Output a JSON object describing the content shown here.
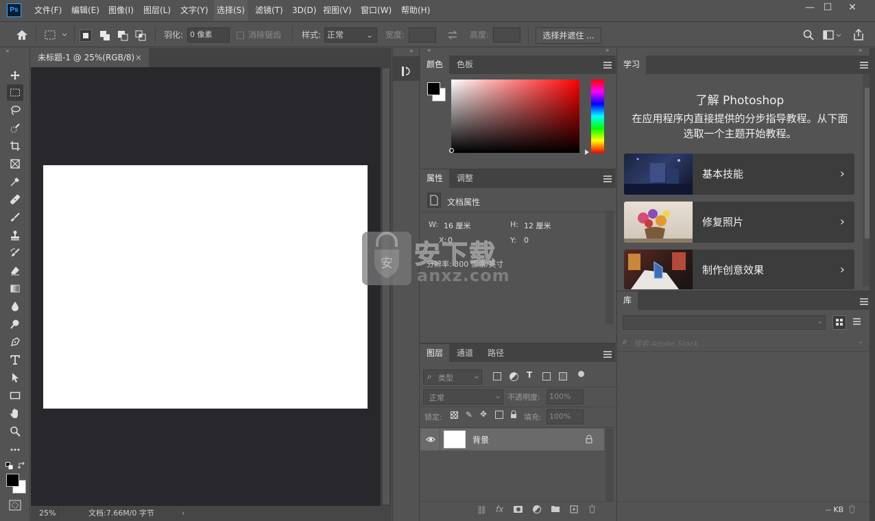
{
  "app": {
    "logo_text": "Ps"
  },
  "menubar": {
    "items": [
      "文件(F)",
      "编辑(E)",
      "图像(I)",
      "图层(L)",
      "文字(Y)",
      "选择(S)",
      "滤镜(T)",
      "3D(D)",
      "视图(V)",
      "窗口(W)",
      "帮助(H)"
    ]
  },
  "window_controls": {
    "minimize": "—",
    "maximize": "☐",
    "close": "✕"
  },
  "options": {
    "feather_label": "羽化:",
    "feather_value": "0 像素",
    "antialias_label": "消除锯齿",
    "style_label": "样式:",
    "style_value": "正常",
    "width_label": "宽度:",
    "height_label": "高度:",
    "select_mask_button": "选择并遮住 ..."
  },
  "document": {
    "tab_title": "未标题-1 @ 25%(RGB/8)",
    "tab_close": "×",
    "zoom": "25%",
    "doc_info": "文档:7.66M/0 字节",
    "status_arrow": "›"
  },
  "color_panel": {
    "tabs": [
      "颜色",
      "色板"
    ]
  },
  "properties_panel": {
    "tabs": [
      "属性",
      "调整"
    ],
    "section_title": "文档属性",
    "w_label": "W:",
    "w_value": "16 厘米",
    "h_label": "H:",
    "h_value": "12 厘米",
    "x_label": "X:",
    "x_value": "0",
    "y_label": "Y:",
    "y_value": "0",
    "resolution": "分辨率: 300 像素/英寸"
  },
  "layers_panel": {
    "tabs": [
      "图层",
      "通道",
      "路径"
    ],
    "filter_kind": "类型",
    "blend_mode": "正常",
    "opacity_label": "不透明度:",
    "opacity_value": "100%",
    "lock_label": "锁定:",
    "fill_label": "填充:",
    "fill_value": "100%",
    "layers": [
      {
        "name": "背景"
      }
    ]
  },
  "learn_panel": {
    "tab": "学习",
    "heading": "了解 Photoshop",
    "description": "在应用程序内直接提供的分步指导教程。从下面选取一个主题开始教程。",
    "cards": [
      {
        "title": "基本技能"
      },
      {
        "title": "修复照片"
      },
      {
        "title": "制作创意效果"
      }
    ]
  },
  "library_panel": {
    "tab": "库",
    "search_placeholder": "搜索 Adobe Stock",
    "size": "-- KB"
  },
  "watermark": {
    "brand": "安下载",
    "domain": "anxz.com"
  },
  "colors": {
    "accent": "#31a8ff",
    "ui_bg": "#535353",
    "canvas_bg": "#28272b",
    "tab_bg": "#424242"
  }
}
